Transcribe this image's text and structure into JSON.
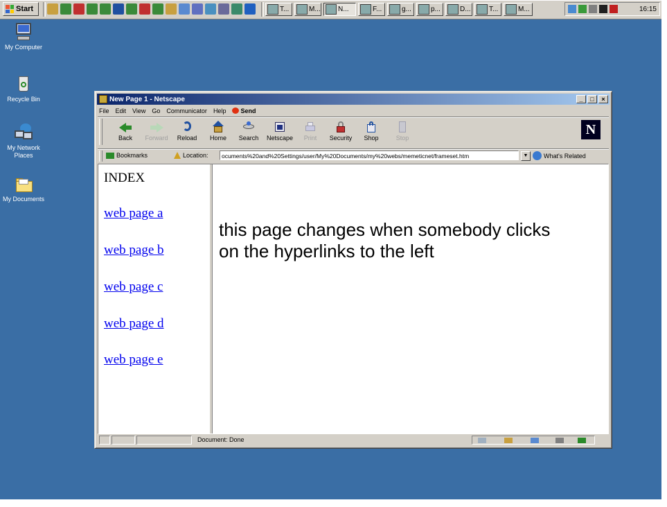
{
  "colors": {
    "desktop": "#3a6ea5",
    "chrome": "#d4d0c8",
    "titlebar_start": "#0a246a",
    "titlebar_end": "#a6caf0",
    "link": "#0000ee"
  },
  "taskbar": {
    "start_label": "Start",
    "quick_launch_icons": [
      "mixer-icon",
      "app-icon",
      "app-icon",
      "app-icon",
      "app-icon",
      "app-icon",
      "app-icon",
      "app-icon",
      "app-icon",
      "app-icon",
      "app-icon",
      "app-icon",
      "app-icon",
      "app-icon",
      "app-icon",
      "app-icon"
    ],
    "tasks": [
      {
        "label": "T...",
        "active": false
      },
      {
        "label": "M...",
        "active": false
      },
      {
        "label": "N...",
        "active": true
      },
      {
        "label": "F...",
        "active": false
      },
      {
        "label": "g...",
        "active": false
      },
      {
        "label": "p...",
        "active": false
      },
      {
        "label": "D...",
        "active": false
      },
      {
        "label": "T...",
        "active": false
      },
      {
        "label": "M...",
        "active": false
      }
    ],
    "clock": "16:15"
  },
  "desktop_icons": [
    {
      "label": "My Computer",
      "icon": "computer-icon"
    },
    {
      "label": "Recycle Bin",
      "icon": "recycle-bin-icon"
    },
    {
      "label": "My Network Places",
      "icon": "network-icon"
    },
    {
      "label": "My Documents",
      "icon": "folder-icon"
    }
  ],
  "window": {
    "title": "New Page 1 - Netscape",
    "menu": [
      "File",
      "Edit",
      "View",
      "Go",
      "Communicator",
      "Help"
    ],
    "send_label": "Send",
    "toolbar": [
      {
        "label": "Back",
        "icon": "back-arrow-icon",
        "enabled": true
      },
      {
        "label": "Forward",
        "icon": "forward-arrow-icon",
        "enabled": false
      },
      {
        "label": "Reload",
        "icon": "reload-icon",
        "enabled": true
      },
      {
        "label": "Home",
        "icon": "home-icon",
        "enabled": true
      },
      {
        "label": "Search",
        "icon": "search-icon",
        "enabled": true
      },
      {
        "label": "Netscape",
        "icon": "netscape-icon",
        "enabled": true
      },
      {
        "label": "Print",
        "icon": "print-icon",
        "enabled": false
      },
      {
        "label": "Security",
        "icon": "lock-icon",
        "enabled": true
      },
      {
        "label": "Shop",
        "icon": "shop-icon",
        "enabled": true
      },
      {
        "label": "Stop",
        "icon": "stop-icon",
        "enabled": false
      }
    ],
    "bookmarks_label": "Bookmarks",
    "location_label": "Location:",
    "location_value": "ocuments%20and%20Settings/user/My%20Documents/my%20webs/memeticnet/frameset.htm",
    "whats_related_label": "What's Related",
    "status_text": "Document: Done"
  },
  "page": {
    "index_title": "INDEX",
    "links": [
      "web page a",
      "web page b",
      "web page c",
      "web page d",
      "web page e"
    ],
    "main_text": "this page changes when somebody clicks on the hyperlinks to the left"
  }
}
